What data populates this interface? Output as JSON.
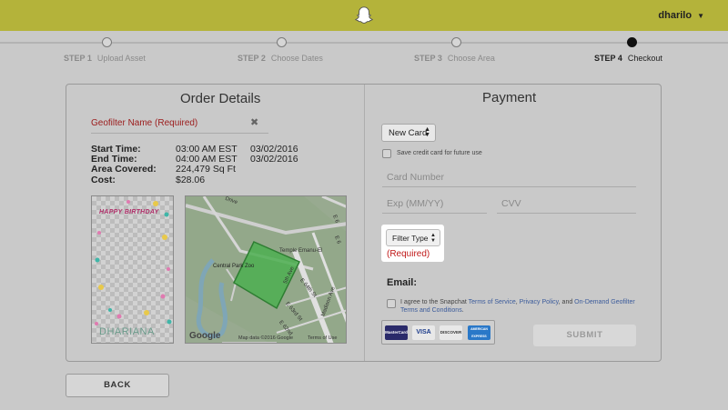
{
  "header": {
    "username": "dharilo"
  },
  "steps": [
    {
      "num": "STEP 1",
      "label": "Upload Asset"
    },
    {
      "num": "STEP 2",
      "label": "Choose Dates"
    },
    {
      "num": "STEP 3",
      "label": "Choose Area"
    },
    {
      "num": "STEP 4",
      "label": "Checkout"
    }
  ],
  "order": {
    "title": "Order Details",
    "geofilter_name_placeholder": "Geofilter Name (Required)",
    "labels": {
      "start": "Start Time:",
      "end": "End Time:",
      "area": "Area Covered:",
      "cost": "Cost:"
    },
    "start_time": "03:00 AM EST",
    "start_date": "03/02/2016",
    "end_time": "04:00 AM EST",
    "end_date": "03/02/2016",
    "area": "224,479 Sq Ft",
    "cost": "$28.06",
    "preview": {
      "top_text": "HAPPY BIRTHDAY",
      "bottom_text": "DHARIANA"
    },
    "map": {
      "labels": [
        "Drive",
        "E 6",
        "E 6",
        "Temple Emanu-El",
        "Central Park Zoo",
        "5th Ave",
        "E 64th St",
        "Madison Ave",
        "E 63rd St",
        "E 62nd"
      ],
      "logo": "Google",
      "data_text": "Map data ©2016 Google",
      "terms_text": "Terms of Use"
    }
  },
  "payment": {
    "title": "Payment",
    "card_select": "New Card",
    "save_card_label": "Save credit card for future use",
    "card_number_placeholder": "Card Number",
    "exp_placeholder": "Exp (MM/YY)",
    "cvv_placeholder": "CVV",
    "filter_type": "Filter Type",
    "filter_required": "(Required)",
    "email_label": "Email:",
    "agree": {
      "prefix": "I agree to the Snapchat ",
      "tos": "Terms of Service",
      "comma": ", ",
      "privacy": "Privacy Policy",
      "and": ", and ",
      "ondemand": "On-Demand Geofilter Terms and Conditions",
      "period": "."
    },
    "card_brands": [
      "MasterCard",
      "VISA",
      "DISCOVER",
      "AMERICAN EXPRESS"
    ],
    "submit": "SUBMIT"
  },
  "back_label": "BACK",
  "colors": {
    "topbar": "#b4b33a",
    "required_red": "#c01818",
    "link_blue": "#3b5b9b"
  }
}
